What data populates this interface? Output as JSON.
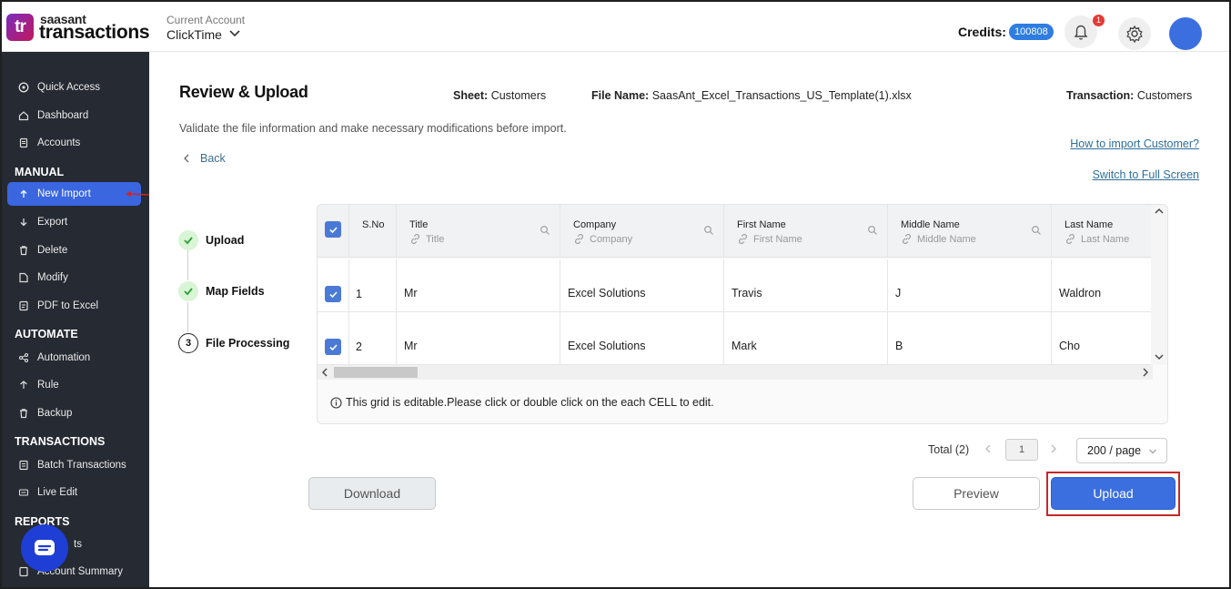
{
  "brand": {
    "logo_text": "tr",
    "top": "saasant",
    "main": "transactions"
  },
  "account": {
    "label": "Current Account",
    "name": "ClickTime"
  },
  "header": {
    "credits_label": "Credits:",
    "credits_value": "100808",
    "notifications": "1"
  },
  "sidebar": {
    "items_top": [
      {
        "label": "Quick Access",
        "icon": "quick-access-icon"
      },
      {
        "label": "Dashboard",
        "icon": "home-icon"
      },
      {
        "label": "Accounts",
        "icon": "accounts-icon"
      }
    ],
    "manual_title": "MANUAL",
    "manual_items": [
      {
        "label": "New Import",
        "icon": "upload-icon",
        "active": true
      },
      {
        "label": "Export",
        "icon": "export-icon"
      },
      {
        "label": "Delete",
        "icon": "trash-icon"
      },
      {
        "label": "Modify",
        "icon": "modify-icon"
      },
      {
        "label": "PDF to Excel",
        "icon": "pdf-icon"
      }
    ],
    "automate_title": "AUTOMATE",
    "automate_items": [
      {
        "label": "Automation",
        "icon": "automation-icon"
      },
      {
        "label": "Rule",
        "icon": "rule-icon"
      },
      {
        "label": "Backup",
        "icon": "backup-icon"
      }
    ],
    "transactions_title": "TRANSACTIONS",
    "transactions_items": [
      {
        "label": "Batch Transactions",
        "icon": "batch-icon"
      },
      {
        "label": "Live Edit",
        "icon": "live-edit-icon"
      }
    ],
    "reports_title": "REPORTS",
    "reports_items": [
      {
        "label": "ts",
        "icon": "reports-icon"
      },
      {
        "label": "Account Summary",
        "icon": "summary-icon"
      }
    ]
  },
  "main": {
    "title": "Review & Upload",
    "sheet_label": "Sheet:",
    "sheet_value": "Customers",
    "file_label": "File Name:",
    "file_value": "SaasAnt_Excel_Transactions_US_Template(1).xlsx",
    "transaction_label": "Transaction:",
    "transaction_value": "Customers",
    "subtitle": "Validate the file information and make necessary modifications before import.",
    "back_label": "Back",
    "how_to_link": "How to import Customer?",
    "fullscreen_link": "Switch to Full Screen"
  },
  "steps": [
    {
      "label": "Upload",
      "state": "done"
    },
    {
      "label": "Map Fields",
      "state": "done"
    },
    {
      "label": "File Processing",
      "state": "current",
      "number": "3"
    }
  ],
  "grid": {
    "sno_header": "S.No",
    "columns": [
      {
        "title": "Title",
        "mapped": "Title"
      },
      {
        "title": "Company",
        "mapped": "Company"
      },
      {
        "title": "First Name",
        "mapped": "First Name"
      },
      {
        "title": "Middle Name",
        "mapped": "Middle Name"
      },
      {
        "title": "Last Name",
        "mapped": "Last Name"
      }
    ],
    "rows": [
      {
        "sno": "1",
        "cells": [
          "Mr",
          "Excel Solutions",
          "Travis",
          "J",
          "Waldron"
        ]
      },
      {
        "sno": "2",
        "cells": [
          "Mr",
          "Excel Solutions",
          "Mark",
          "B",
          "Cho"
        ]
      }
    ],
    "note": "This grid is editable.Please click or double click on the each CELL to edit."
  },
  "pagination": {
    "total": "Total (2)",
    "page": "1",
    "per_page": "200 / page"
  },
  "buttons": {
    "download": "Download",
    "preview": "Preview",
    "upload": "Upload"
  },
  "colors": {
    "accent": "#3b6fe0",
    "sidebar": "#252a33",
    "highlight": "#c62828"
  }
}
